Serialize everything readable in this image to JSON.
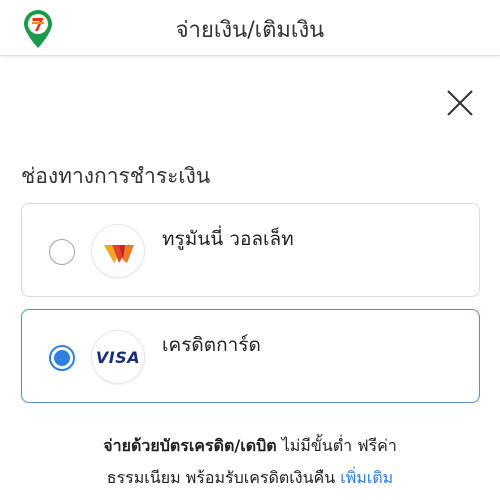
{
  "header": {
    "title": "จ่ายเงิน/เติมเงิน",
    "logo_icon": "7-eleven-pin-icon"
  },
  "close_icon": "close-icon",
  "section": {
    "title": "ช่องทางการชำระเงิน"
  },
  "options": [
    {
      "label": "ทรูมันนี่ วอลเล็ท",
      "icon": "truemoney-wallet-icon",
      "selected": false
    },
    {
      "label": "เครดิตการ์ด",
      "icon": "visa-icon",
      "badge_text": "VISA",
      "selected": true
    }
  ],
  "footer": {
    "line1_bold": "จ่ายด้วยบัตรเครดิต/เดบิต",
    "line1_rest": " ไม่มีขั้นต่ำ ฟรีค่า",
    "line2": "ธรรมเนียม พร้อมรับเครดิตเงินคืน ",
    "link": "เพิ่มเติม"
  },
  "colors": {
    "accent": "#2d7fe0",
    "selected_border": "#5a8fc4",
    "brand_green": "#1a9a4a"
  }
}
